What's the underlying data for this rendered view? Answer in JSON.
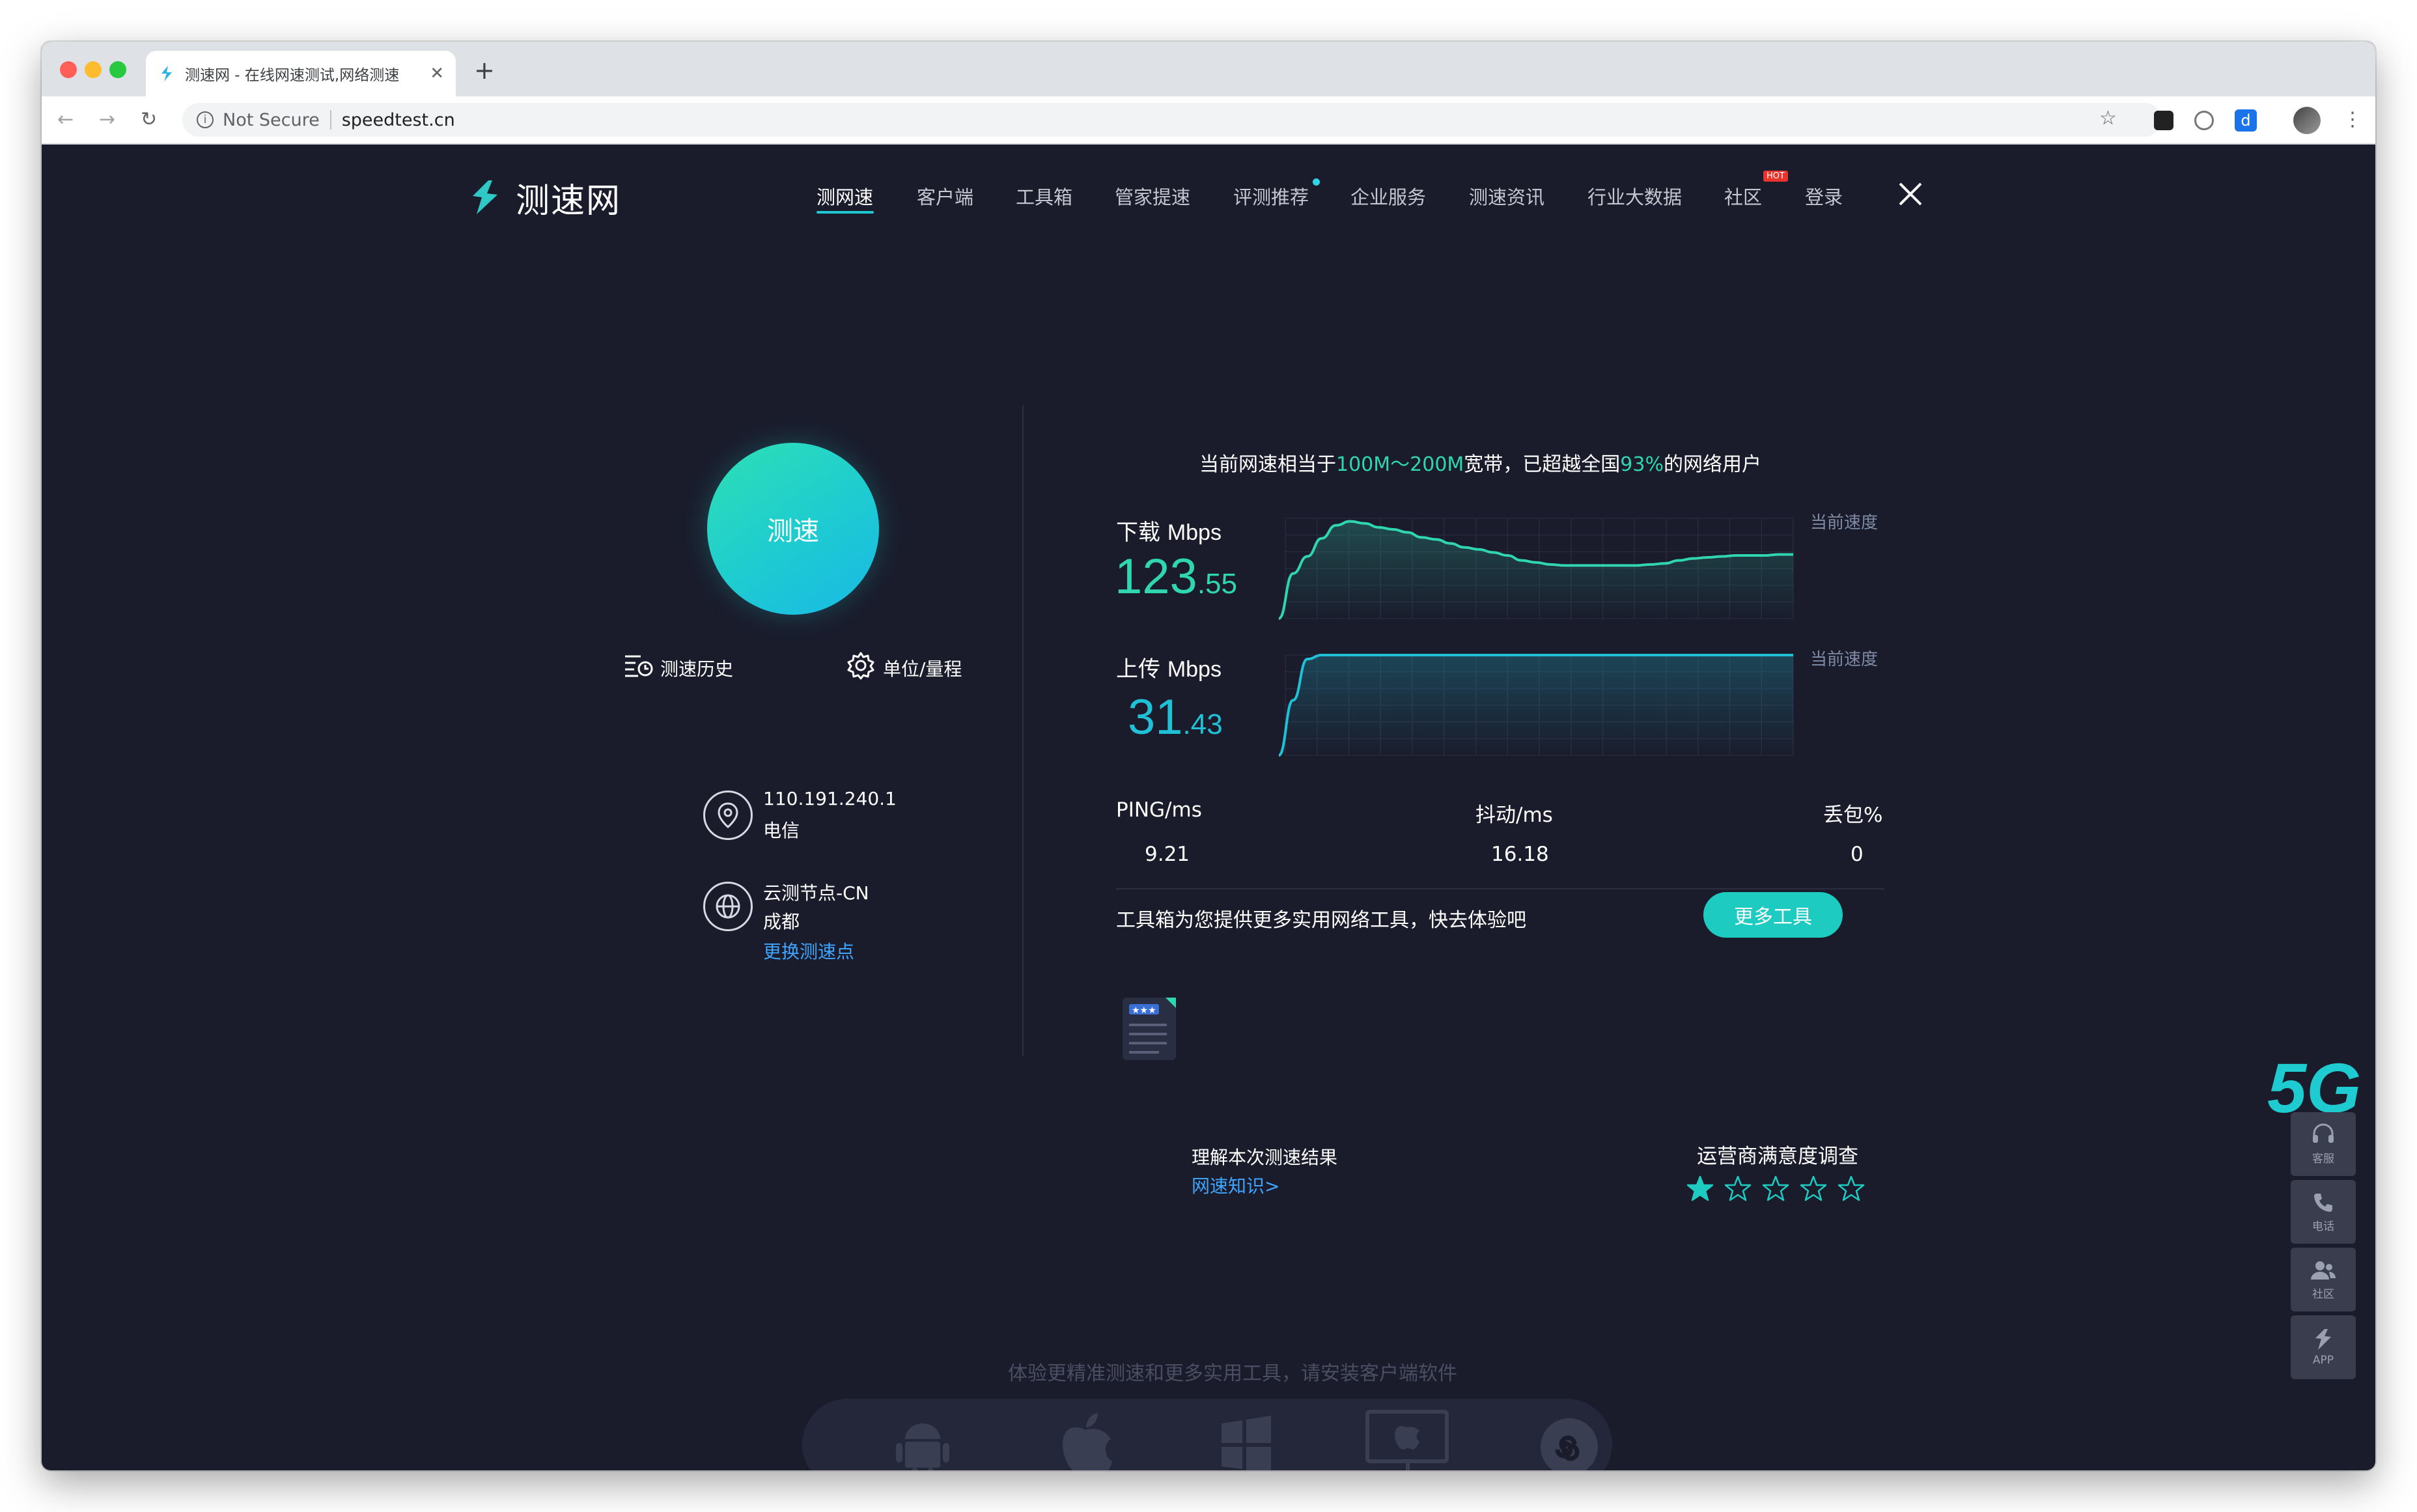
{
  "browser": {
    "tab_title": "测速网 - 在线网速测试,网络测速",
    "new_tab": "+",
    "security_label": "Not Secure",
    "url": "speedtest.cn"
  },
  "nav": {
    "logo": "测速网",
    "items": [
      "测网速",
      "客户端",
      "工具箱",
      "管家提速",
      "评测推荐",
      "企业服务",
      "测速资讯",
      "行业大数据",
      "社区",
      "登录"
    ],
    "hot_badge": "HOT"
  },
  "left": {
    "start_button": "测速",
    "history": "测速历史",
    "units": "单位/量程",
    "ip": "110.191.240.1",
    "isp": "电信",
    "node": "云测节点-CN",
    "city": "成都",
    "change_node": "更换测速点"
  },
  "summary": {
    "part1": "当前网速相当于",
    "bandwidth": "100M～200M",
    "part2": "宽带，已超越全国",
    "percent": "93%",
    "part3": "的网络用户"
  },
  "download": {
    "label": "下载",
    "unit": "Mbps",
    "int": "123",
    "dec": ".55",
    "legend": "当前速度",
    "curve": [
      0,
      0.45,
      0.62,
      0.8,
      0.93,
      0.97,
      0.95,
      0.91,
      0.89,
      0.86,
      0.81,
      0.79,
      0.75,
      0.71,
      0.69,
      0.66,
      0.63,
      0.58,
      0.56,
      0.54,
      0.53,
      0.53,
      0.53,
      0.53,
      0.53,
      0.53,
      0.54,
      0.55,
      0.58,
      0.6,
      0.61,
      0.62,
      0.63,
      0.63,
      0.63,
      0.64,
      0.64
    ]
  },
  "upload": {
    "label": "上传",
    "unit": "Mbps",
    "int": "31",
    "dec": ".43",
    "legend": "当前速度",
    "curve": [
      0,
      0.55,
      0.96,
      1.0,
      1.0,
      1.0,
      1.0,
      1.0,
      1.0,
      1.0,
      1.0,
      1.0,
      1.0,
      1.0,
      1.0,
      1.0,
      1.0,
      1.0,
      1.0,
      1.0,
      1.0,
      1.0,
      1.0,
      1.0,
      1.0,
      1.0,
      1.0,
      1.0,
      1.0,
      1.0,
      1.0,
      1.0,
      1.0,
      1.0,
      1.0,
      1.0,
      1.0
    ]
  },
  "stats": {
    "ping_label": "PING/ms",
    "ping": "9.21",
    "jitter_label": "抖动/ms",
    "jitter": "16.18",
    "loss_label": "丢包%",
    "loss": "0"
  },
  "tools": {
    "text": "工具箱为您提供更多实用网络工具，快去体验吧",
    "button": "更多工具"
  },
  "knowledge": {
    "title": "理解本次测速结果",
    "link": "网速知识>"
  },
  "survey": {
    "title": "运营商满意度调查",
    "rating": 1,
    "max": 5
  },
  "side": {
    "badge": "5G",
    "service": "客服",
    "phone": "电话",
    "community": "社区",
    "app": "APP"
  },
  "footer": {
    "text": "体验更精准测速和更多实用工具，请安装客户端软件"
  },
  "colors": {
    "accent": "#1ecbc1",
    "download": "#2fd6b0",
    "upload": "#20c1d6",
    "background": "#1a1c2c"
  }
}
